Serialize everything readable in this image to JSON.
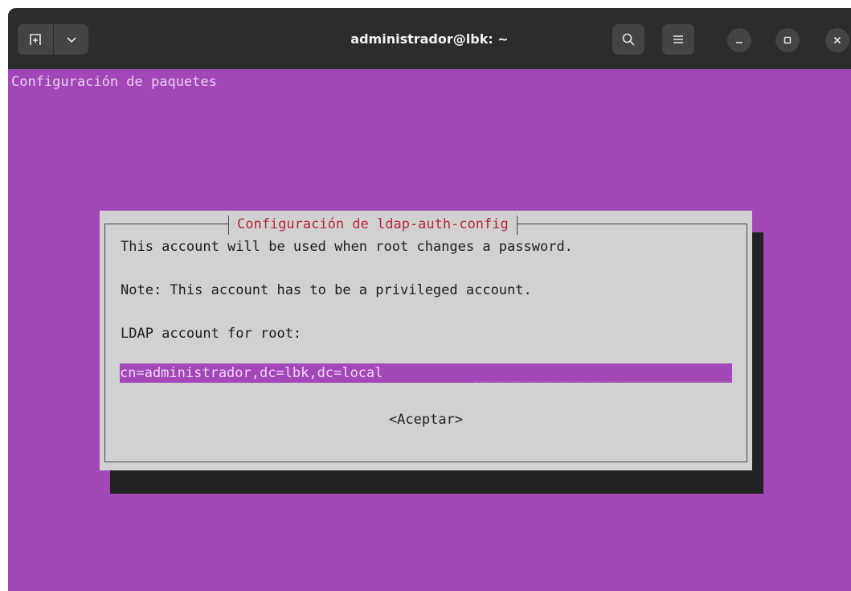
{
  "window": {
    "title": "administrador@lbk: ~",
    "icons": {
      "new_tab": "new-tab-icon",
      "dropdown": "chevron-down-icon",
      "search": "search-icon",
      "menu": "hamburger-menu-icon",
      "minimize": "minimize-icon",
      "maximize": "maximize-icon",
      "close": "close-icon"
    }
  },
  "terminal": {
    "header": "Configuración de paquetes",
    "background": "#a346b8"
  },
  "dialog": {
    "title": "Configuración de ldap-auth-config",
    "line1": "This account will be used when root changes a password.",
    "line2": "Note: This account has to be a privileged account.",
    "prompt": "LDAP account for root:",
    "input_value": "cn=administrador,dc=lbk,dc=local",
    "button": "<Aceptar>",
    "title_color": "#b5243a"
  }
}
